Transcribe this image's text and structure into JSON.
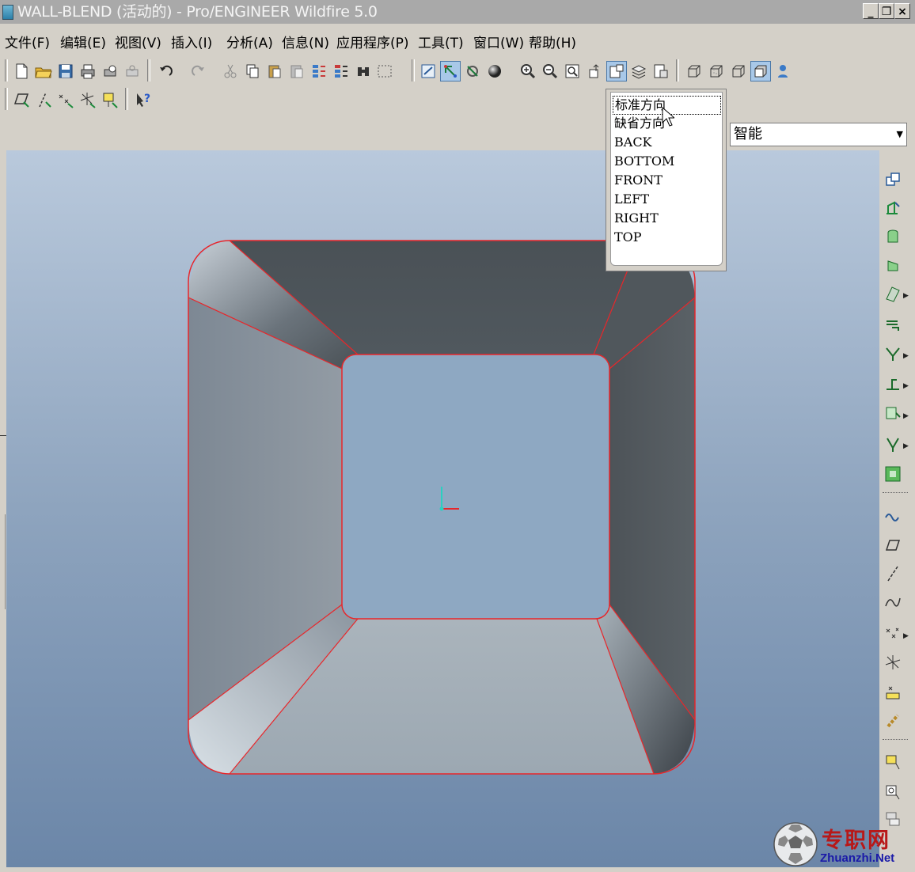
{
  "window": {
    "title": "WALL-BLEND (活动的) - Pro/ENGINEER Wildfire 5.0",
    "controls": [
      "_",
      "❐",
      "×"
    ]
  },
  "menu": {
    "items": [
      "文件(F)",
      "编辑(E)",
      "视图(V)",
      "插入(I)",
      "分析(A)",
      "信息(N)",
      "应用程序(P)",
      "工具(T)",
      "窗口(W)",
      "帮助(H)"
    ]
  },
  "filter": {
    "selected": "智能"
  },
  "view_dropdown": {
    "items": [
      "标准方向",
      "缺省方向",
      "BACK",
      "BOTTOM",
      "FRONT",
      "LEFT",
      "RIGHT",
      "TOP"
    ],
    "selected_index": 0
  },
  "watermark": {
    "name": "专职网",
    "url": "Zhuanzhi.Net"
  },
  "colors": {
    "edge": "#e8262a",
    "viewport_top": "#b9c9dc",
    "viewport_bottom": "#6b86a8",
    "active_button": "#a8c8e8"
  }
}
